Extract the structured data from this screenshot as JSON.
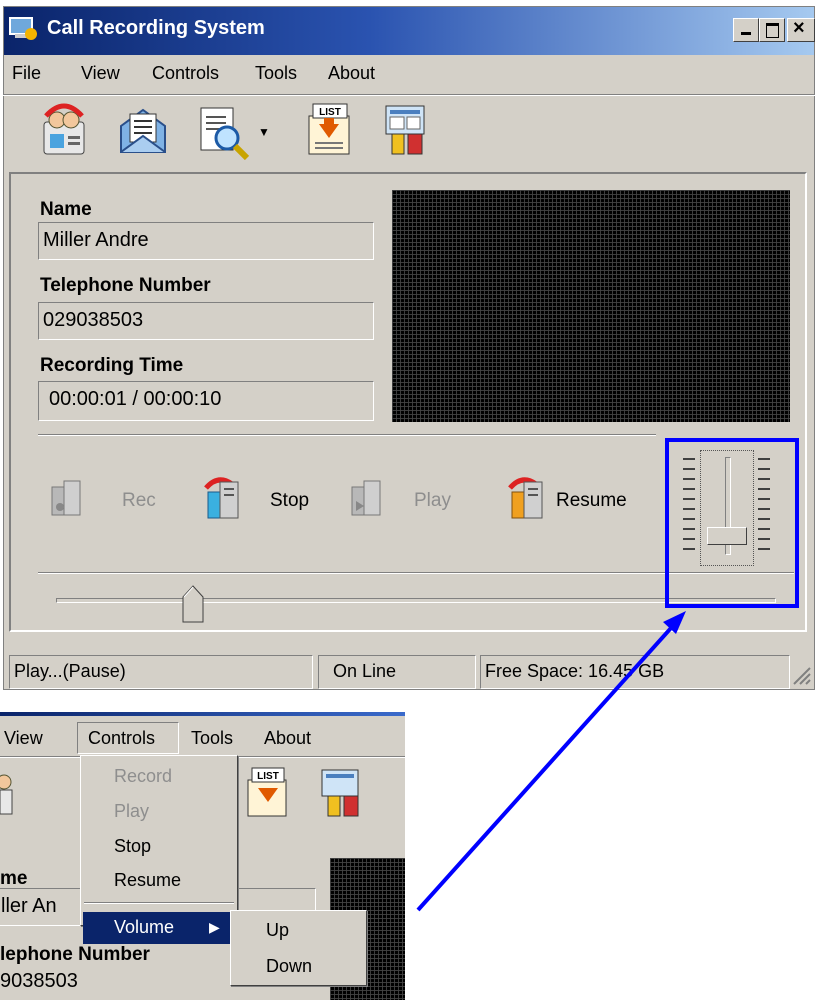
{
  "window": {
    "title": "Call Recording System",
    "minimize_glyph": "_",
    "maximize_glyph": "□",
    "close_glyph": "×"
  },
  "menubar": [
    "File",
    "View",
    "Controls",
    "Tools",
    "About"
  ],
  "toolbar": {
    "icons": [
      "contacts-icon",
      "message-icon",
      "search-document-icon",
      "dropdown-arrow-icon",
      "list-icon",
      "settings-tools-icon"
    ]
  },
  "info": {
    "name_label": "Name",
    "name_value": "Miller Andre",
    "phone_label": "Telephone Number",
    "phone_value": "029038503",
    "time_label": "Recording Time",
    "time_value": "00:00:01 / 00:00:10"
  },
  "controls": {
    "rec": "Rec",
    "stop": "Stop",
    "play": "Play",
    "resume": "Resume"
  },
  "position_slider_fraction": 0.19,
  "volume_fraction": 0.2,
  "statusbar": {
    "state": "Play...(Pause)",
    "line": "On Line",
    "space": "Free Space: 16.45 GB"
  },
  "crop": {
    "menubar": [
      "View",
      "Controls",
      "Tools",
      "About"
    ],
    "controls_menu": [
      "Record",
      "Play",
      "Stop",
      "Resume",
      "Volume"
    ],
    "volume_submenu": [
      "Up",
      "Down"
    ],
    "partial_labels": {
      "name": "me",
      "name_value": "ller An",
      "phone": "lephone Number",
      "phone_value": "9038503"
    }
  },
  "colors": {
    "highlight": "#0000ff",
    "arrow": "#0000ff",
    "menu_selected": "#0a246a",
    "titlebar": "#0a246a"
  }
}
